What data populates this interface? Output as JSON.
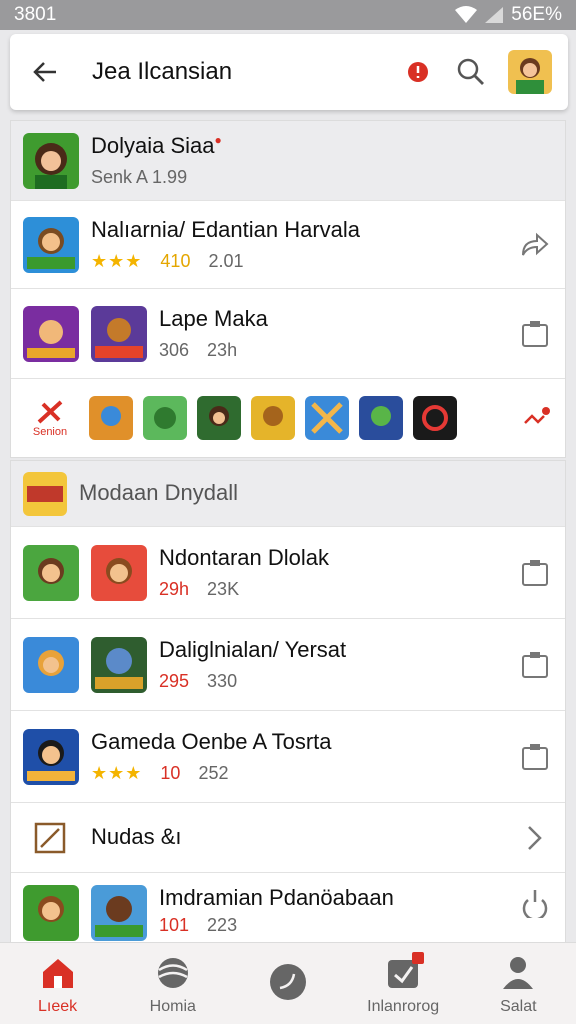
{
  "status": {
    "time": "3801",
    "battery": "56E%"
  },
  "header": {
    "title": "Jea Ilcansian"
  },
  "top_card": {
    "title": "Dolyaia Siaa",
    "subtitle": "Senk A 1.99"
  },
  "list_one": [
    {
      "title": "Nalıarnia/ Edantian Harvala",
      "stars": "★★★",
      "score": "410",
      "extra": "2.01",
      "trail": "share-icon"
    },
    {
      "title": "Lape Maka",
      "score": "306",
      "extra": "23h",
      "trail": "clipboard-icon"
    }
  ],
  "strip": {
    "label": "Senion"
  },
  "section_two": {
    "title": "Modaan Dnydall"
  },
  "list_two": [
    {
      "title": "Ndontaran Dlolak",
      "score": "29h",
      "extra": "23K",
      "trail": "clipboard-icon"
    },
    {
      "title": "Daliglnialan/ Yersat",
      "score": "295",
      "extra": "330",
      "trail": "clipboard-icon"
    },
    {
      "title": "Gameda Oenbe A Tosrta",
      "stars": "★★★",
      "score": "10",
      "extra": "252",
      "trail": "clipboard-icon"
    }
  ],
  "nudes_row": {
    "label": "Nudas &ı"
  },
  "bottom_row": {
    "title": "Imdramian Pdanöabaan",
    "score": "101",
    "extra": "223"
  },
  "tabs": [
    {
      "label": "Lıeek",
      "active": true
    },
    {
      "label": "Homia"
    },
    {
      "label": ""
    },
    {
      "label": "Inlanrorog"
    },
    {
      "label": "Salat"
    }
  ],
  "colors": {
    "accent": "#d93025",
    "star": "#f4b400",
    "status_bar": "#9a9a9c"
  }
}
